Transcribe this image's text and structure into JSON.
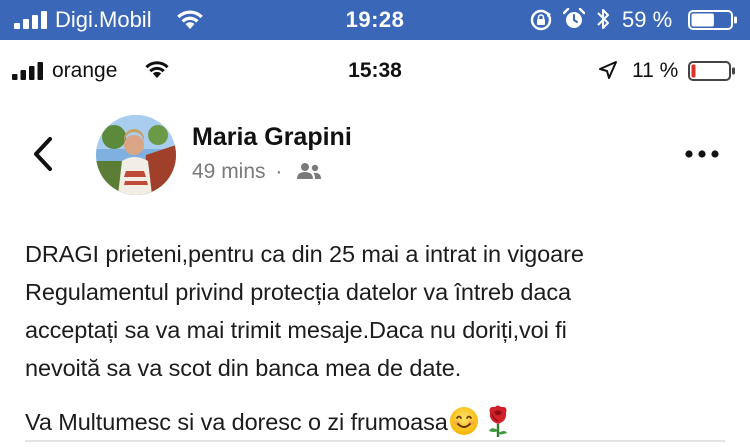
{
  "outer_status_bar": {
    "carrier": "Digi.Mobil",
    "time": "19:28",
    "battery_percent": "59 %",
    "battery_level": 0.59,
    "icons": [
      "signal-icon",
      "wifi-icon",
      "rotation-lock-icon",
      "alarm-icon",
      "bluetooth-icon",
      "battery-icon"
    ],
    "color": "#3a67b8"
  },
  "inner_status_bar": {
    "carrier": "orange",
    "time": "15:38",
    "battery_percent": "11 %",
    "battery_level": 0.11,
    "icons": [
      "signal-icon",
      "wifi-icon",
      "location-arrow-icon",
      "battery-low-icon"
    ],
    "low_battery_color": "#e0302b"
  },
  "post": {
    "author": "Maria Grapini",
    "time_ago": "49 mins",
    "separator": "·",
    "audience_icon": "friends-icon",
    "body_lines": [
      "DRAGI prieteni,pentru ca din 25 mai a intrat in vigoare",
      "Regulamentul privind protecția datelor va întreb daca",
      "acceptați sa va mai trimit mesaje.Daca nu doriți,voi fi",
      "nevoită sa va scot din banca mea de date."
    ],
    "closing": "Va Multumesc si va doresc o zi frumoasa",
    "closing_emojis": [
      "smiling-face-emoji",
      "rose-emoji"
    ]
  },
  "nav": {
    "back_icon": "chevron-left-icon",
    "more_icon": "more-options-icon"
  }
}
